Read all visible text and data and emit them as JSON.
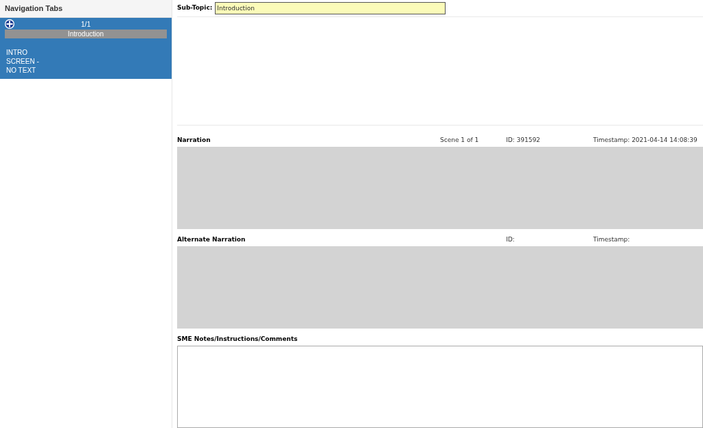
{
  "sidebar": {
    "title": "Navigation Tabs",
    "tabs": [
      {
        "counter": "1/1",
        "label": "Introduction",
        "text": "INTRO SCREEN - NO TEXT",
        "selected": true
      }
    ]
  },
  "sub_topic": {
    "label": "Sub-Topic:",
    "value": "Introduction"
  },
  "sections": [
    {
      "title": "Narration",
      "scene": "Scene 1 of 1",
      "id": "ID: 391592",
      "timestamp": "Timestamp: 2021-04-14 14:08:39",
      "disabled": true
    },
    {
      "title": "Alternate Narration",
      "id": "ID:",
      "timestamp": "Timestamp:",
      "disabled": true
    },
    {
      "title": "SME Notes/Instructions/Comments",
      "disabled": false
    }
  ]
}
